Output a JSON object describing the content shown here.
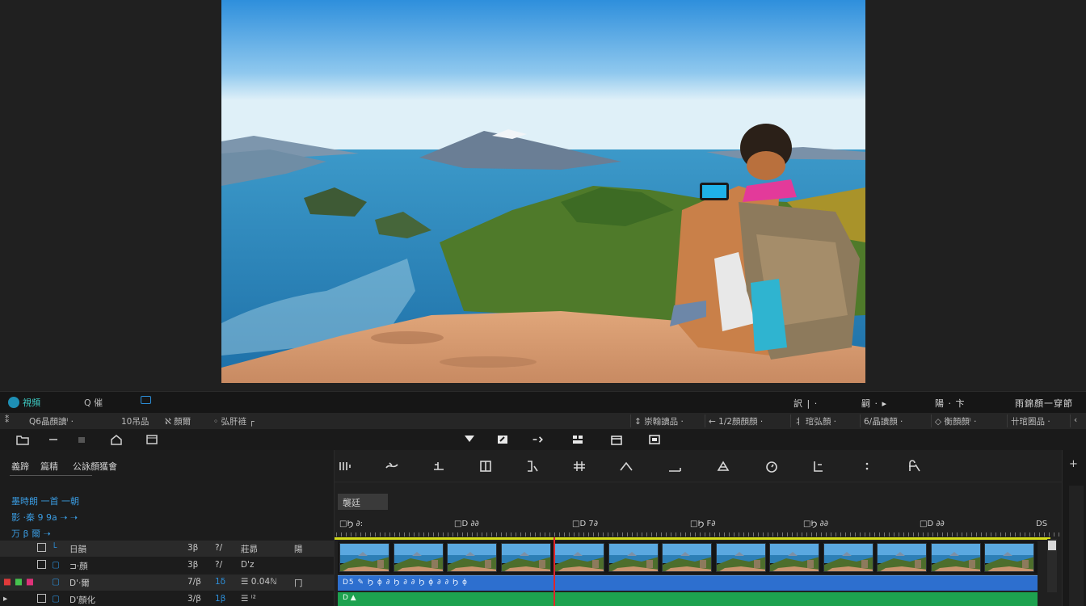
{
  "panel_tabs": {
    "media": "視頻",
    "search": "Q 催",
    "chat": ""
  },
  "right_tools": {
    "t1": "訳 | ·",
    "t2": "嗣 · ▸",
    "t3": "陽 · 卞",
    "t4": "雨錦顏一穿節"
  },
  "toolbar2": {
    "left": [
      "⁑",
      "Q6晶顏讀ⁱ ·",
      "10吊品",
      "ℵ 顏爾",
      "◦ 弘肝裢 ┌"
    ],
    "right": [
      "↕ 崇翰讀品 ·",
      "← 1/2顏顏顏 ·",
      "丬 琯弘顏 ·",
      "6/晶讀顏 ·",
      "◇ 衡顏顏ⁱ ·",
      "卄琯圈品 ·",
      "‹"
    ]
  },
  "left_panel": {
    "tabs": [
      "義蹄",
      "篇精",
      "公詠顏獲會"
    ],
    "line1": "墨時朗 一首 一朝",
    "line2": "影 ·秦     9     9a     ➝ ➝",
    "line3": "万     β     爾     ➝",
    "tracks": [
      {
        "name": "日韻",
        "c1": "3β",
        "c2": "?/",
        "c3": "莊昴",
        "c4": "陽"
      },
      {
        "name": "⊐·顏",
        "c1": "3β",
        "c2": "?/",
        "c3": "Ⅾ'z",
        "c4": ""
      },
      {
        "name": "Ⅾ'·爾",
        "c1": "7/β",
        "c2": "1δ",
        "c3": "☰ 0.04ℕ",
        "c4": "冂"
      },
      {
        "name": "Ⅾ'顏化",
        "c1": "3/β",
        "c2": "1β",
        "c3": "☰ ⁱ² ",
        "c4": ""
      }
    ]
  },
  "timeline": {
    "label": "襲廷",
    "ruler": [
      "□Ϧ ∂:",
      "□Ⅾ ∂∂",
      "□Ⅾ 7∂",
      "□Ϧ Ϝ∂",
      "□Ϧ ∂∂",
      "□Ⅾ ∂∂",
      "ⅮS"
    ],
    "audio_label": "Ⅾ5 ✎ Ϧ ϕ ∂ Ϧ ∂ ∂ Ϧ ϕ ∂ ∂ Ϧ ϕ",
    "green_label": "Ⅾ ▲",
    "thumb_count": 13,
    "playhead_pct": 30.6
  },
  "colors": {
    "accent_teal": "#3fd0c8",
    "accent_blue": "#2c8ed8",
    "audio_track": "#2d6fcf",
    "green_track": "#1da24f",
    "ruler_line": "#d4dc1a",
    "playhead": "#e0262b"
  },
  "icons": {
    "panel_tabs": [
      "media-icon",
      "search-icon",
      "chat-icon"
    ],
    "toolbar3_left": [
      "folder-icon",
      "minus-icon",
      "square-icon",
      "home-icon",
      "window-icon"
    ],
    "toolbar3_center": [
      "filter-icon",
      "edit-icon",
      "transform-icon",
      "grid-icon",
      "calendar-icon",
      "stop-icon"
    ],
    "timeline_tools": [
      "split-icon",
      "transition-icon",
      "text-icon",
      "crop-icon",
      "speed-icon",
      "hash-icon",
      "mountain-icon",
      "line-icon",
      "mask-icon",
      "timer-icon",
      "bracket-icon",
      "colon-icon",
      "fx-icon"
    ]
  }
}
